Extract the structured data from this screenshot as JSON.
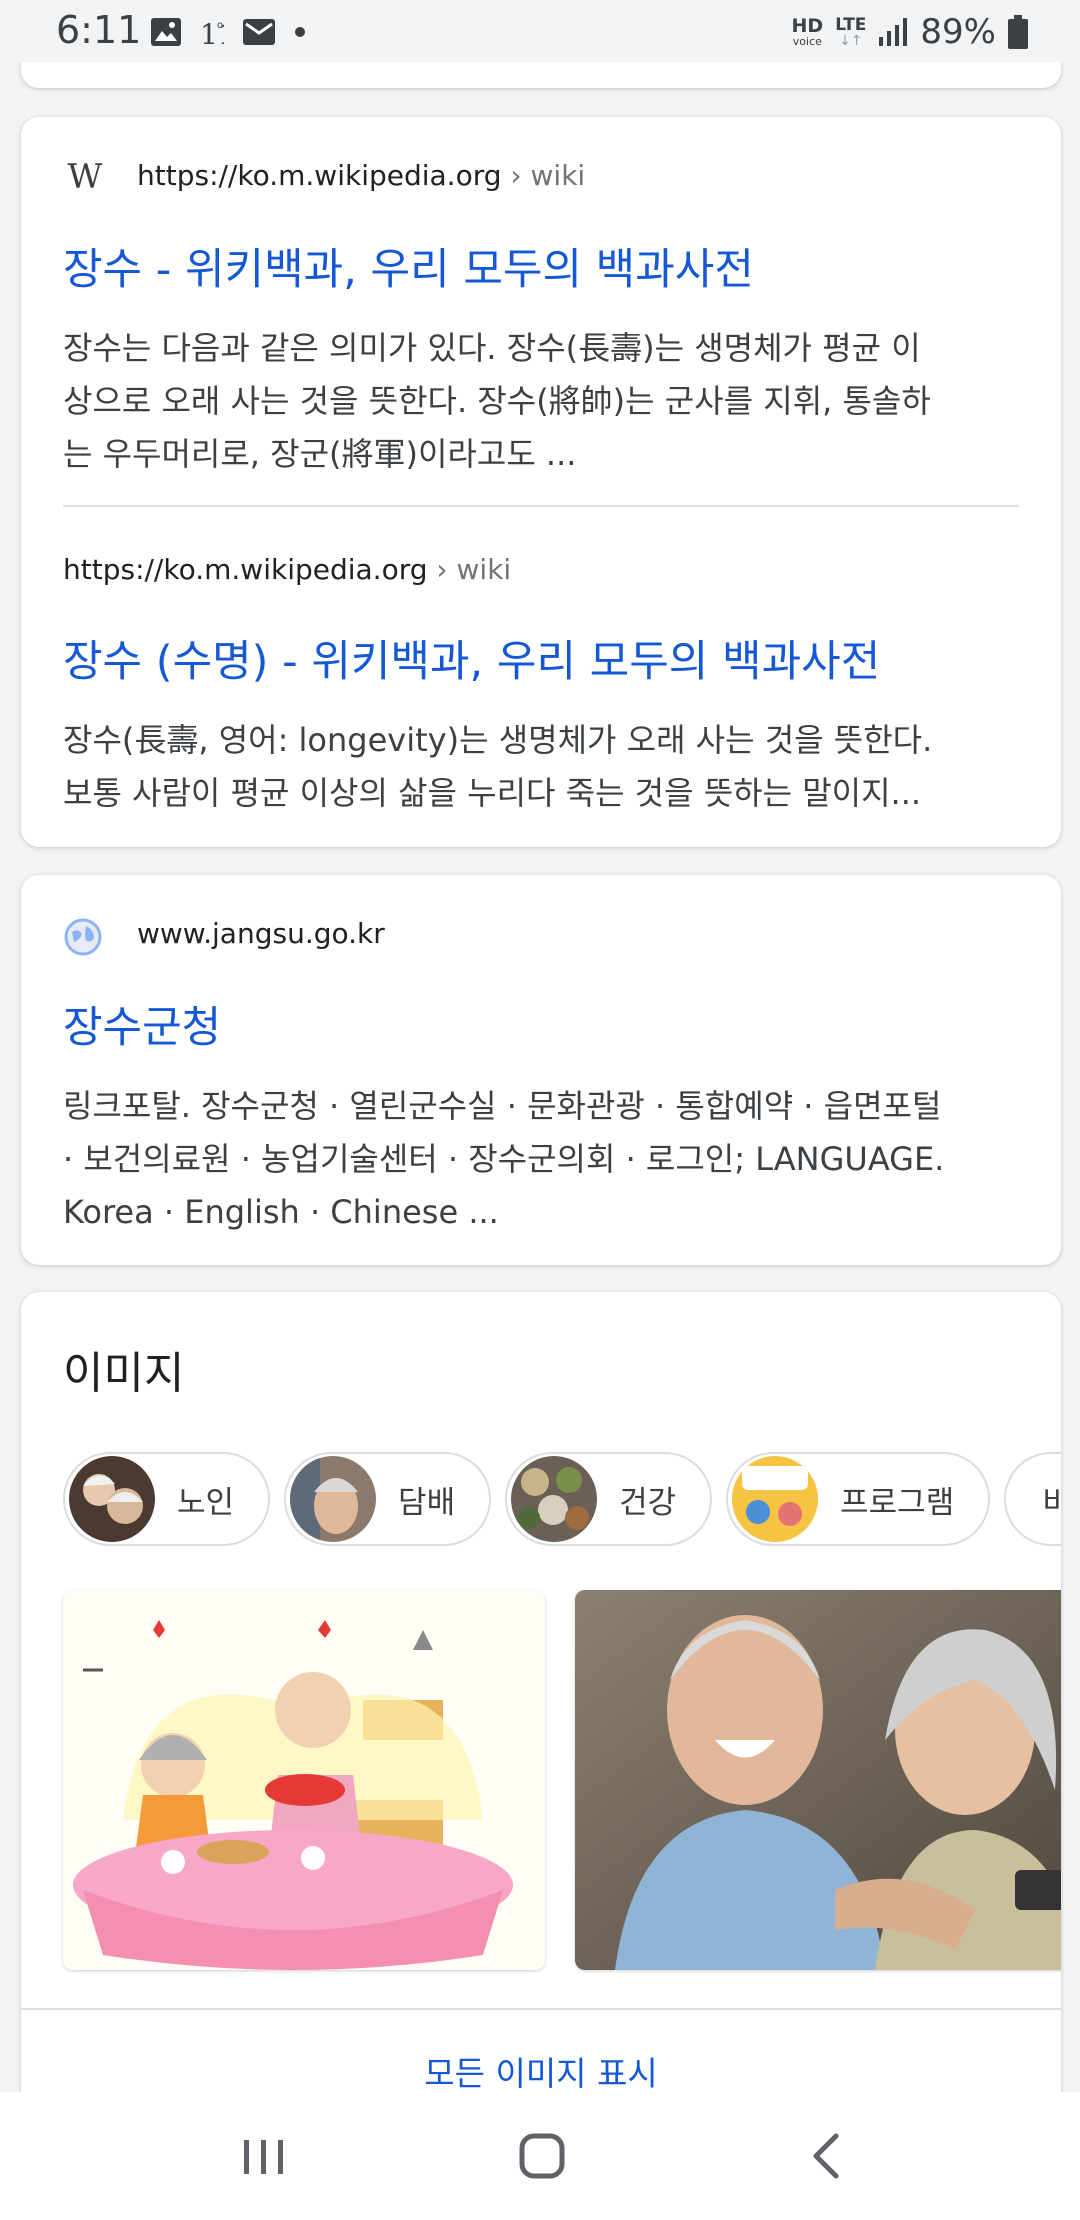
{
  "status_bar": {
    "time": "6:11",
    "hd": "HD",
    "voice": "voice",
    "lte": "LTE",
    "battery": "89%",
    "icons": [
      "gallery-icon",
      "11st-icon",
      "mail-icon",
      "dot-icon",
      "signal-icon",
      "battery-icon"
    ]
  },
  "results": [
    {
      "favicon": "W",
      "domain": "https://ko.m.wikipedia.org",
      "crumb": " › wiki",
      "title": "장수 - 위키백과, 우리 모두의 백과사전",
      "snippet_lines": [
        "장수는 다음과 같은 의미가 있다. 장수(長壽)는 생명체가 평균 이",
        "상으로 오래 사는 것을 뜻한다. 장수(將帥)는 군사를 지휘, 통솔하",
        "는 우두머리로, 장군(將軍)이라고도 ..."
      ]
    },
    {
      "domain": "https://ko.m.wikipedia.org",
      "crumb": " › wiki",
      "title": "장수 (수명) - 위키백과, 우리 모두의 백과사전",
      "snippet_lines": [
        "장수(長壽, 영어: longevity)는 생명체가 오래 사는 것을 뜻한다.",
        "보통 사람이 평균 이상의 삶을 누리다 죽는 것을 뜻하는 말이지..."
      ]
    },
    {
      "domain": "www.jangsu.go.kr",
      "title": "장수군청",
      "snippet_lines": [
        "링크포탈. 장수군청 · 열린군수실 · 문화관광 · 통합예약 · 읍면포털",
        "· 보건의료원 · 농업기술센터 · 장수군의회 · 로그인; LANGUAGE.",
        "Korea · English · Chinese ..."
      ]
    }
  ],
  "images": {
    "title": "이미지",
    "chips": [
      "노인",
      "담배",
      "건강",
      "프로그램",
      "비결"
    ],
    "show_all": "모든 이미지 표시"
  },
  "colors": {
    "link": "#1558d6",
    "background": "#f1f3f4"
  }
}
